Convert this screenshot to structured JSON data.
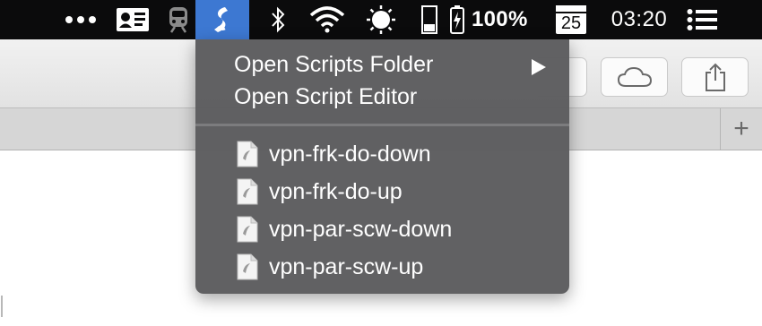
{
  "menubar": {
    "icons": [
      "more-dots-icon",
      "contact-card-icon",
      "train-icon",
      "scripts-menu-icon",
      "bluetooth-icon",
      "wifi-icon",
      "brightness-icon",
      "battery-widget-icon",
      "battery-charging-icon",
      "calendar-icon",
      "notification-center-icon"
    ],
    "battery_percent": "100%",
    "calendar_day": "25",
    "clock": "03:20",
    "accent_color": "#3d78d2"
  },
  "toolbar": {
    "buttons": [
      "icloud-tabs-icon",
      "share-icon"
    ]
  },
  "tabbar": {
    "new_tab_label": "+"
  },
  "menu": {
    "items": [
      {
        "label": "Open Scripts Folder",
        "has_submenu": true
      },
      {
        "label": "Open Script Editor",
        "has_submenu": false
      }
    ],
    "scripts": [
      {
        "label": "vpn-frk-do-down"
      },
      {
        "label": "vpn-frk-do-up"
      },
      {
        "label": "vpn-par-scw-down"
      },
      {
        "label": "vpn-par-scw-up"
      }
    ]
  }
}
